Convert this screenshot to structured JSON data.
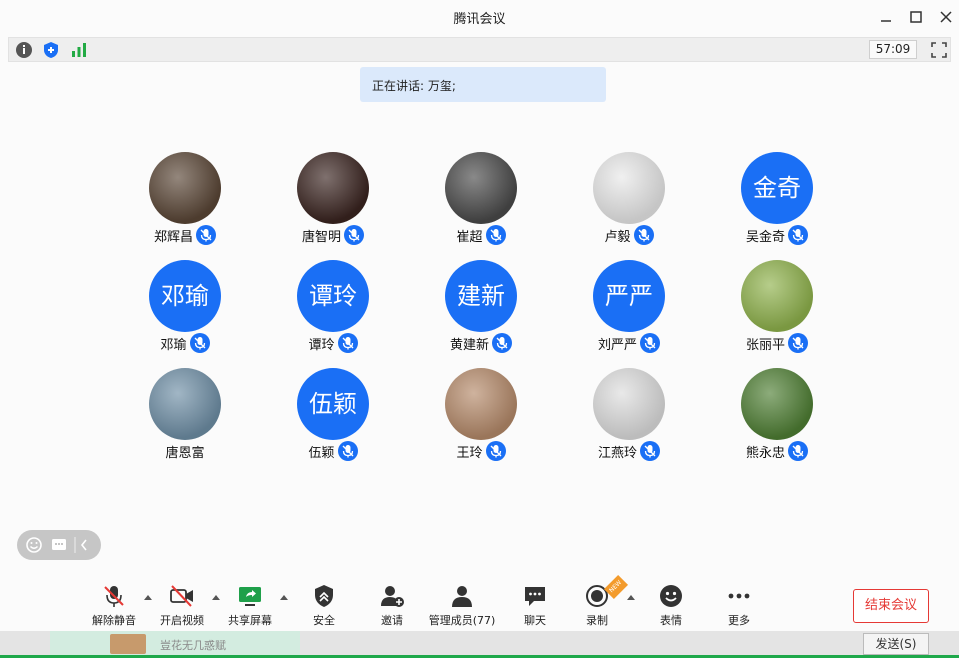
{
  "window": {
    "title": "腾讯会议"
  },
  "infobar": {
    "timer": "57:09"
  },
  "speaking": {
    "text": "正在讲话: 万玺;"
  },
  "participants": [
    {
      "name": "郑辉昌",
      "avatar_type": "photo",
      "avatar_text": "",
      "avatar_color": "#5a4636"
    },
    {
      "name": "唐智明",
      "avatar_type": "photo",
      "avatar_text": "",
      "avatar_color": "#3a2420"
    },
    {
      "name": "崔超",
      "avatar_type": "photo",
      "avatar_text": "",
      "avatar_color": "#4a4a4a"
    },
    {
      "name": "卢毅",
      "avatar_type": "photo",
      "avatar_text": "",
      "avatar_color": "#e8e8e8"
    },
    {
      "name": "吴金奇",
      "avatar_type": "text",
      "avatar_text": "金奇",
      "avatar_color": "#1a6ff5"
    },
    {
      "name": "邓瑜",
      "avatar_type": "text",
      "avatar_text": "邓瑜",
      "avatar_color": "#1a6ff5"
    },
    {
      "name": "谭玲",
      "avatar_type": "text",
      "avatar_text": "谭玲",
      "avatar_color": "#1a6ff5"
    },
    {
      "name": "黄建新",
      "avatar_type": "text",
      "avatar_text": "建新",
      "avatar_color": "#1a6ff5"
    },
    {
      "name": "刘严严",
      "avatar_type": "text",
      "avatar_text": "严严",
      "avatar_color": "#1a6ff5"
    },
    {
      "name": "张丽平",
      "avatar_type": "photo",
      "avatar_text": "",
      "avatar_color": "#8fb24c"
    },
    {
      "name": "唐恩富",
      "avatar_type": "photo",
      "avatar_text": "",
      "avatar_color": "#6f8fa6",
      "no_mic": true
    },
    {
      "name": "伍颖",
      "avatar_type": "text",
      "avatar_text": "伍颖",
      "avatar_color": "#1a6ff5"
    },
    {
      "name": "王玲",
      "avatar_type": "photo",
      "avatar_text": "",
      "avatar_color": "#b58a6a"
    },
    {
      "name": "江燕玲",
      "avatar_type": "photo",
      "avatar_text": "",
      "avatar_color": "#dddddd"
    },
    {
      "name": "熊永忠",
      "avatar_type": "photo",
      "avatar_text": "",
      "avatar_color": "#4f7f34"
    }
  ],
  "toolbar": {
    "unmute": "解除静音",
    "start_video": "开启视频",
    "share_screen": "共享屏幕",
    "security": "安全",
    "invite": "邀请",
    "manage_members": "管理成员(77)",
    "chat": "聊天",
    "record": "录制",
    "emoji": "表情",
    "more": "更多",
    "end_meeting": "结束会议",
    "record_badge": "NEW"
  },
  "bottom_strip": {
    "text": "豈花无几惑赋",
    "send": "发送(S)"
  },
  "colors": {
    "accent": "#1a6ff5",
    "danger": "#e53935",
    "speaking_bg": "#dbe9fb"
  }
}
